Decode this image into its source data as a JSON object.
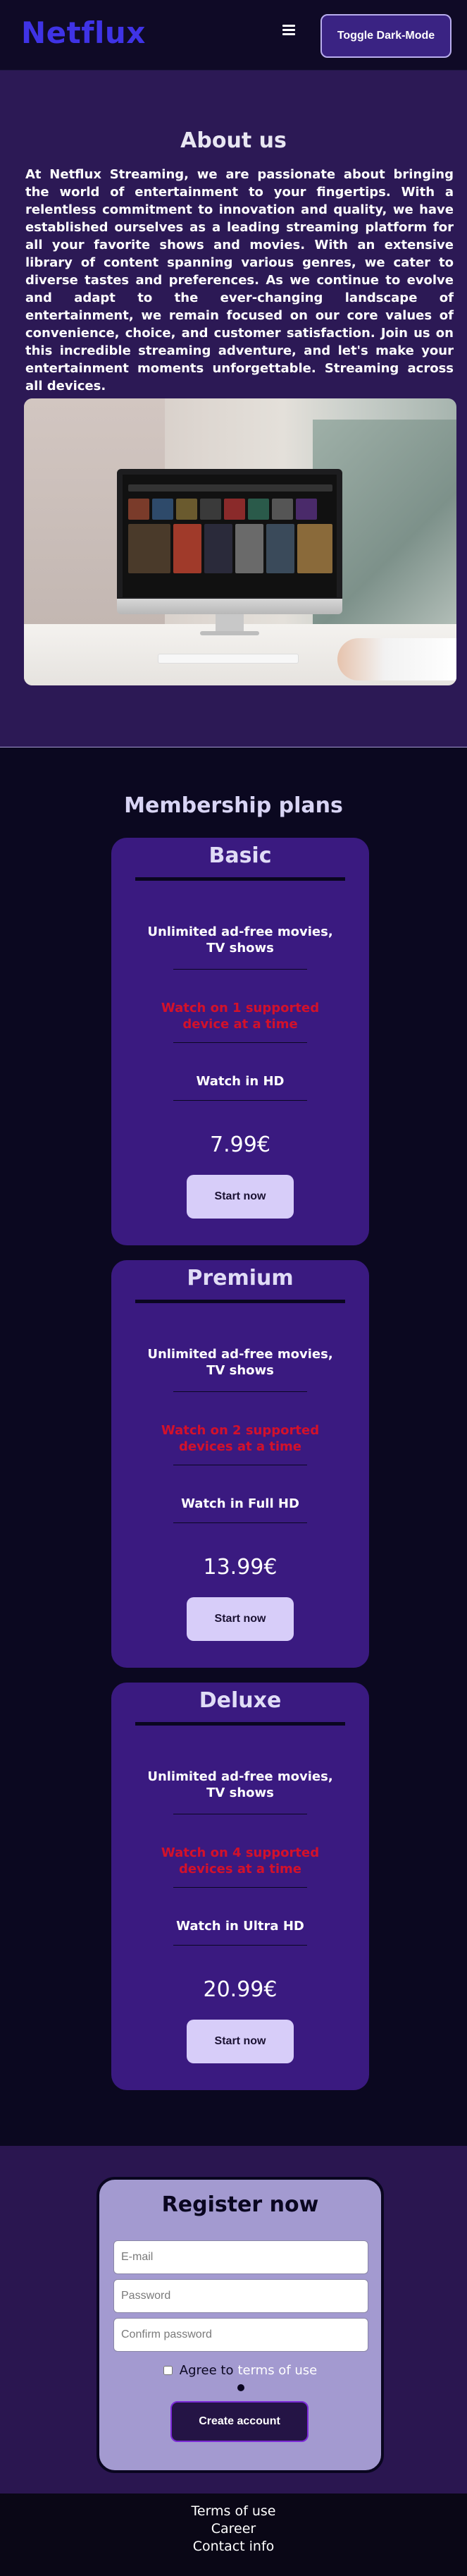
{
  "header": {
    "logo": "Netflux",
    "menu_icon": "hamburger-menu-icon",
    "toggle_label": "Toggle Dark-Mode"
  },
  "about": {
    "title": "About us",
    "text": "At Netflux Streaming, we are passionate about bringing the world of entertainment to your fingertips. With a relentless commitment to innovation and quality, we have established ourselves as a leading streaming platform for all your favorite shows and movies. With an extensive library of content spanning various genres, we cater to diverse tastes and preferences. As we continue to evolve and adapt to the ever-changing landscape of entertainment, we remain focused on our core values of convenience, choice, and customer satisfaction. Join us on this incredible streaming adventure, and let's make your entertainment moments unforgettable. Streaming across all devices."
  },
  "plans": {
    "title": "Membership plans",
    "items": [
      {
        "name": "Basic",
        "feature1": "Unlimited ad-free movies, TV shows",
        "feature2": "Watch on 1 supported device at a time",
        "feature3": "Watch in HD",
        "price": "7.99€",
        "button": "Start now"
      },
      {
        "name": "Premium",
        "feature1": "Unlimited ad-free movies, TV shows",
        "feature2": "Watch on 2 supported devices at a time",
        "feature3": "Watch in Full HD",
        "price": "13.99€",
        "button": "Start now"
      },
      {
        "name": "Deluxe",
        "feature1": "Unlimited ad-free movies, TV shows",
        "feature2": "Watch on 4 supported devices at a time",
        "feature3": "Watch in Ultra HD",
        "price": "20.99€",
        "button": "Start now"
      }
    ]
  },
  "register": {
    "title": "Register now",
    "email_placeholder": "E-mail",
    "password_placeholder": "Password",
    "confirm_placeholder": "Confirm password",
    "agree_prefix": "Agree to",
    "terms_link": "terms of use",
    "button": "Create account"
  },
  "footer": {
    "links": [
      "Terms of use",
      "Career",
      "Contact info"
    ]
  },
  "colors": {
    "logo": "#3f33e6",
    "about_bg": "#2c1955",
    "card_bg": "#3a1a80",
    "highlight_red": "#d3112a",
    "register_card_bg": "#a39ad0"
  }
}
